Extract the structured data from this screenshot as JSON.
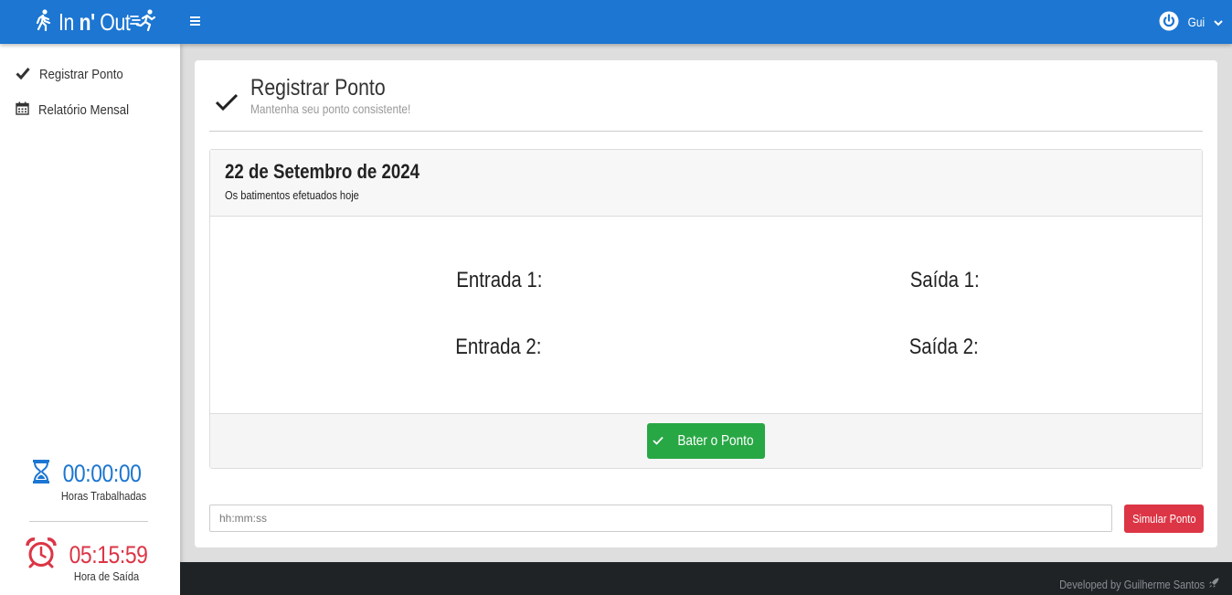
{
  "header": {
    "brand_prefix": "In ",
    "brand_bold": "n'",
    "brand_suffix": " Out",
    "user_name": "Gui"
  },
  "sidebar": {
    "items": [
      {
        "label": "Registrar Ponto",
        "icon": "check-icon"
      },
      {
        "label": "Relatório Mensal",
        "icon": "calendar-icon"
      }
    ],
    "worked": {
      "time": "00:00:00",
      "label": "Horas Trabalhadas",
      "color": "#1c76d2"
    },
    "exit": {
      "time": "05:15:59",
      "label": "Hora de Saída",
      "color": "#dc3545"
    }
  },
  "page": {
    "title": "Registrar Ponto",
    "subtitle": "Mantenha seu ponto consistente!"
  },
  "punches": {
    "date": "22 de Setembro de 2024",
    "subtitle": "Os batimentos efetuados hoje",
    "entrada1": "Entrada 1:",
    "saida1": "Saída 1:",
    "entrada2": "Entrada 2:",
    "saida2": "Saída 2:",
    "button": "Bater o Ponto"
  },
  "simulate": {
    "placeholder": "hh:mm:ss",
    "button": "Simular Ponto"
  },
  "footer": {
    "credit": "Developed by Guilherme Santos"
  },
  "colors": {
    "primary": "#1c76d2",
    "success": "#28a745",
    "danger": "#dc3545",
    "footer": "#1f2326"
  }
}
